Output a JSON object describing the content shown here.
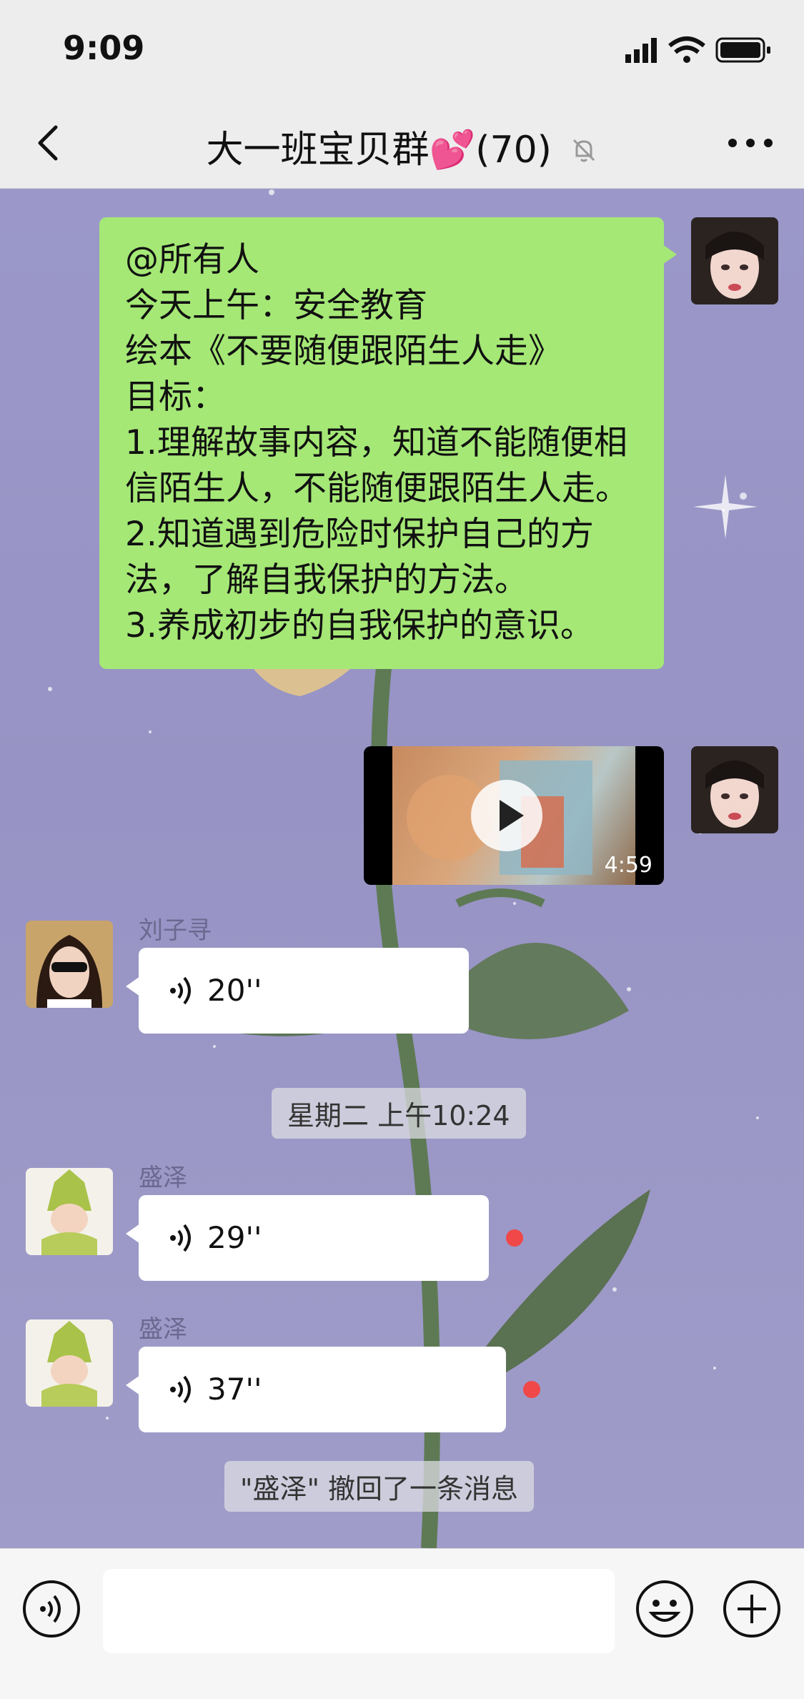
{
  "status_bar": {
    "time": "9:09"
  },
  "nav": {
    "title": "大一班宝贝群💕(70)"
  },
  "messages": {
    "announcement": "@所有人\n今天上午：安全教育\n绘本《不要随便跟陌生人走》\n目标：\n1.理解故事内容，知道不能随便相信陌生人，不能随便跟陌生人走。\n2.知道遇到危险时保护自己的方法，了解自我保护的方法。\n3.养成初步的自我保护的意识。",
    "video_duration": "4:59",
    "voice1": {
      "sender": "刘子寻",
      "duration": "20''"
    },
    "timestamp": "星期二 上午10:24",
    "voice2": {
      "sender": "盛泽",
      "duration": "29''"
    },
    "voice3": {
      "sender": "盛泽",
      "duration": "37''"
    },
    "recall_notice": "\"盛泽\" 撤回了一条消息"
  },
  "colors": {
    "chat_background": "#9b98c9",
    "sent_bubble": "#a5e876",
    "unread_dot": "#f04848"
  },
  "icons": [
    "back-icon",
    "mute-bell-icon",
    "more-icon",
    "play-icon",
    "voice-icon",
    "microphone-icon",
    "emoji-icon",
    "plus-icon"
  ]
}
